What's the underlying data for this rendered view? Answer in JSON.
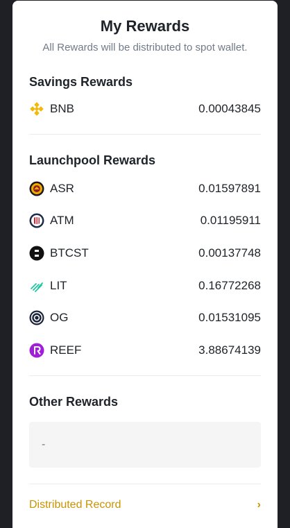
{
  "header": {
    "title": "My Rewards",
    "subtitle": "All Rewards will be distributed to spot wallet."
  },
  "savings": {
    "title": "Savings Rewards",
    "items": [
      {
        "coin": "BNB",
        "amount": "0.00043845",
        "icon": "bnb-icon"
      }
    ]
  },
  "launchpool": {
    "title": "Launchpool Rewards",
    "items": [
      {
        "coin": "ASR",
        "amount": "0.01597891",
        "icon": "asr-icon"
      },
      {
        "coin": "ATM",
        "amount": "0.01195911",
        "icon": "atm-icon"
      },
      {
        "coin": "BTCST",
        "amount": "0.00137748",
        "icon": "btcst-icon"
      },
      {
        "coin": "LIT",
        "amount": "0.16772268",
        "icon": "lit-icon"
      },
      {
        "coin": "OG",
        "amount": "0.01531095",
        "icon": "og-icon"
      },
      {
        "coin": "REEF",
        "amount": "3.88674139",
        "icon": "reef-icon"
      }
    ]
  },
  "other": {
    "title": "Other Rewards",
    "empty_value": "-"
  },
  "footer": {
    "link_label": "Distributed Record",
    "chevron": "›"
  },
  "colors": {
    "accent": "#c99400",
    "bnb": "#f0b90b",
    "lit": "#1fc7a0",
    "reef": "#a11fd8"
  }
}
